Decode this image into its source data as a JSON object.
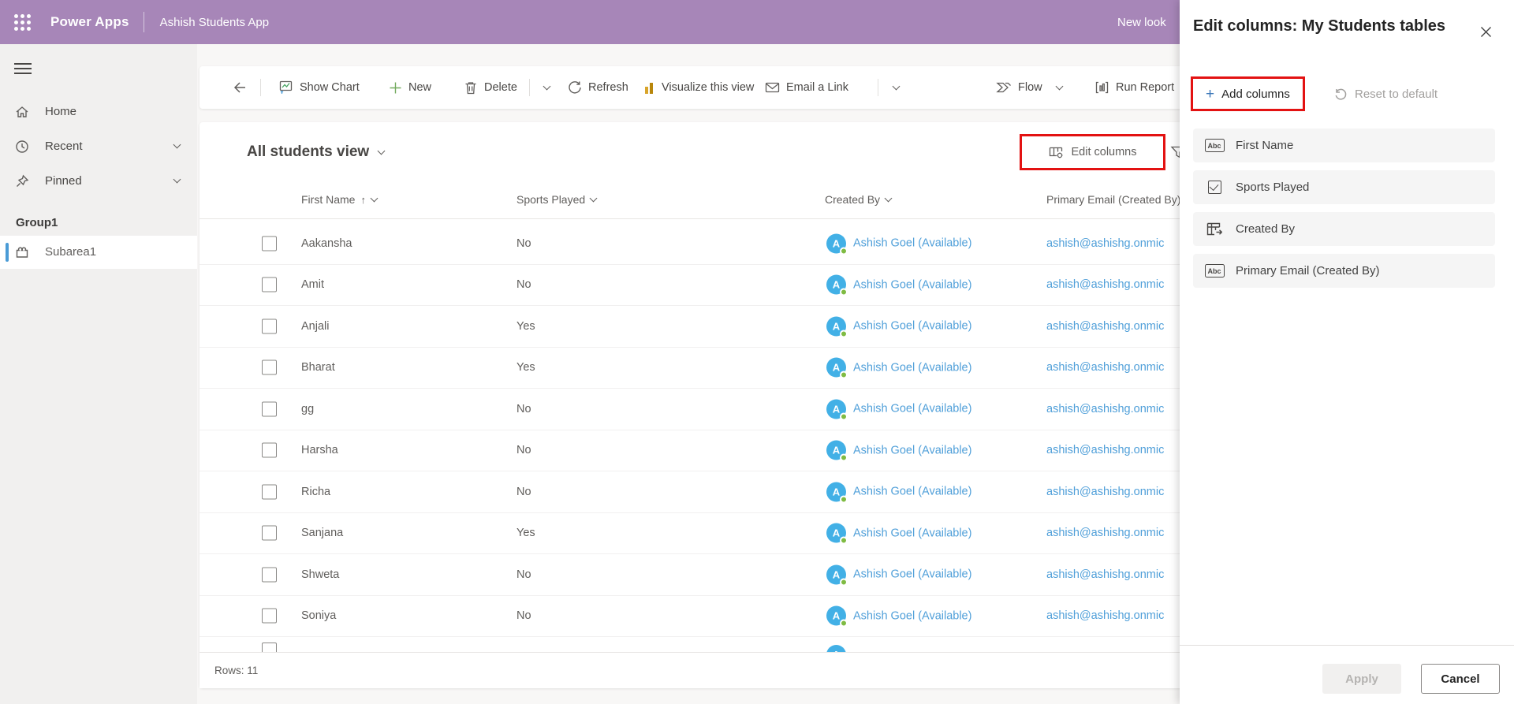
{
  "topbar": {
    "app_name": "Power Apps",
    "app_title": "Ashish Students App",
    "new_look_label": "New look"
  },
  "sidebar": {
    "items": [
      {
        "label": "Home",
        "icon": "home-icon",
        "chevron": false
      },
      {
        "label": "Recent",
        "icon": "clock-icon",
        "chevron": true
      },
      {
        "label": "Pinned",
        "icon": "pin-icon",
        "chevron": true
      }
    ],
    "group_label": "Group1",
    "subarea": {
      "label": "Subarea1",
      "icon": "puzzle-icon",
      "selected": true
    }
  },
  "toolbar": {
    "show_chart_label": "Show Chart",
    "new_label": "New",
    "delete_label": "Delete",
    "refresh_label": "Refresh",
    "visualize_label": "Visualize this view",
    "email_link_label": "Email a Link",
    "flow_label": "Flow",
    "run_report_label": "Run Report"
  },
  "view": {
    "title": "All students view",
    "edit_columns_label": "Edit columns",
    "rows_count_label": "Rows: 11"
  },
  "grid": {
    "columns": {
      "first_name": "First Name",
      "sports": "Sports Played",
      "created_by": "Created By",
      "email": "Primary Email (Created By)"
    },
    "sorted_column": "First Name",
    "avatar_initial": "A",
    "rows": [
      {
        "first_name": "Aakansha",
        "sports": "No",
        "created_by": "Ashish Goel (Available)",
        "email": "ashish@ashishg.onmic"
      },
      {
        "first_name": "Amit",
        "sports": "No",
        "created_by": "Ashish Goel (Available)",
        "email": "ashish@ashishg.onmic"
      },
      {
        "first_name": "Anjali",
        "sports": "Yes",
        "created_by": "Ashish Goel (Available)",
        "email": "ashish@ashishg.onmic"
      },
      {
        "first_name": "Bharat",
        "sports": "Yes",
        "created_by": "Ashish Goel (Available)",
        "email": "ashish@ashishg.onmic"
      },
      {
        "first_name": "gg",
        "sports": "No",
        "created_by": "Ashish Goel (Available)",
        "email": "ashish@ashishg.onmic"
      },
      {
        "first_name": "Harsha",
        "sports": "No",
        "created_by": "Ashish Goel (Available)",
        "email": "ashish@ashishg.onmic"
      },
      {
        "first_name": "Richa",
        "sports": "No",
        "created_by": "Ashish Goel (Available)",
        "email": "ashish@ashishg.onmic"
      },
      {
        "first_name": "Sanjana",
        "sports": "Yes",
        "created_by": "Ashish Goel (Available)",
        "email": "ashish@ashishg.onmic"
      },
      {
        "first_name": "Shweta",
        "sports": "No",
        "created_by": "Ashish Goel (Available)",
        "email": "ashish@ashishg.onmic"
      },
      {
        "first_name": "Soniya",
        "sports": "No",
        "created_by": "Ashish Goel (Available)",
        "email": "ashish@ashishg.onmic"
      }
    ]
  },
  "panel": {
    "title": "Edit columns: My Students tables",
    "add_columns_label": "Add columns",
    "reset_label": "Reset to default",
    "abc_icon_text": "Abc",
    "items": [
      {
        "label": "First Name",
        "type": "text"
      },
      {
        "label": "Sports Played",
        "type": "boolean"
      },
      {
        "label": "Created By",
        "type": "lookup"
      },
      {
        "label": "Primary Email (Created By)",
        "type": "text"
      }
    ],
    "apply_label": "Apply",
    "cancel_label": "Cancel"
  },
  "colors": {
    "topbar_purple": "#a786b8",
    "highlight_red": "#e31212",
    "link_blue": "#4f9fd9",
    "avatar_blue": "#42b0e6",
    "presence_green": "#7fbb42",
    "selection_blue": "#4a9bd6",
    "add_plus_blue": "#3a76b8"
  }
}
